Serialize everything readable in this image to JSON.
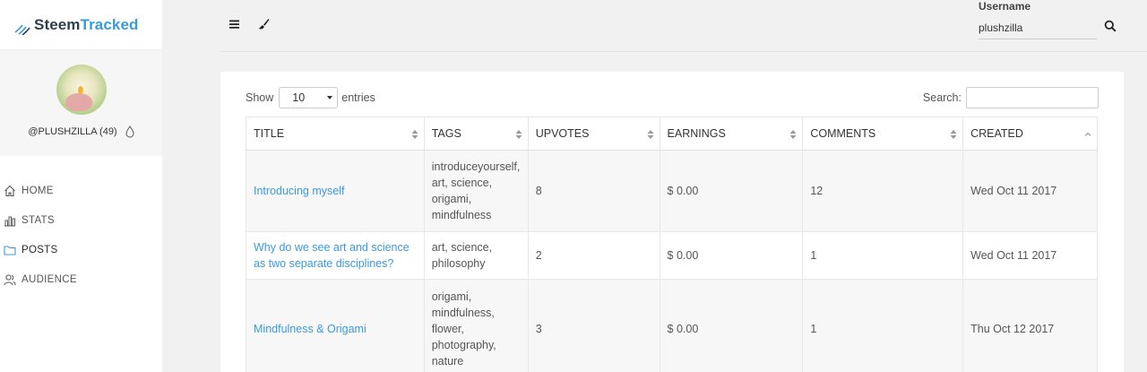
{
  "brand": {
    "part1": "Steem",
    "part2": "Tracked"
  },
  "profile": {
    "handle": "@PLUSHZILLA (49)"
  },
  "nav": [
    {
      "label": "HOME",
      "icon": "home-icon"
    },
    {
      "label": "STATS",
      "icon": "bar-chart-icon"
    },
    {
      "label": "POSTS",
      "icon": "folder-icon"
    },
    {
      "label": "AUDIENCE",
      "icon": "users-icon"
    }
  ],
  "topbar": {
    "username_label": "Username",
    "username_value": "plushzilla"
  },
  "table_controls": {
    "show": "Show",
    "entries_value": "10",
    "entries": "entries",
    "search_label": "Search:"
  },
  "table": {
    "headers": [
      "TITLE",
      "TAGS",
      "UPVOTES",
      "EARNINGS",
      "COMMENTS",
      "CREATED"
    ],
    "rows": [
      {
        "title": "Introducing myself",
        "tags": "introduceyourself,\nart, science,\norigami,\nmindfulness",
        "upvotes": "8",
        "earnings": "$ 0.00",
        "comments": "12",
        "created": "Wed Oct 11 2017"
      },
      {
        "title": "Why do we see art and science as two separate disciplines?",
        "tags": "art, science,\nphilosophy",
        "upvotes": "2",
        "earnings": "$ 0.00",
        "comments": "1",
        "created": "Wed Oct 11 2017"
      },
      {
        "title": "Mindfulness & Origami",
        "tags": "origami,\nmindfulness,\nflower,\nphotography,\nnature",
        "upvotes": "3",
        "earnings": "$ 0.00",
        "comments": "1",
        "created": "Thu Oct 12 2017"
      }
    ]
  },
  "colors": {
    "accent": "#3a9bdc",
    "brand_dark": "#2c3e50",
    "background": "#f1f1f1"
  }
}
